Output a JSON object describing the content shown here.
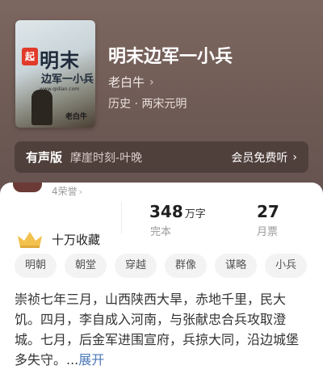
{
  "cover": {
    "badge": "起",
    "title": "明末",
    "subtitle": "边军一小兵",
    "url": "www.qidian.com",
    "author": "老白牛"
  },
  "book": {
    "title": "明末边军一小兵",
    "author": "老白牛",
    "genre": "历史 · 两宋元明"
  },
  "audio": {
    "label": "有声版",
    "narrator": "摩崖时刻-叶晚",
    "vip": "会员免费听"
  },
  "honor": {
    "label": "4荣誉"
  },
  "collection": {
    "label": "十万收藏"
  },
  "stats": {
    "words_num": "348",
    "words_unit": "万字",
    "words_label": "完本",
    "tickets_num": "27",
    "tickets_label": "月票"
  },
  "tags": [
    "明朝",
    "朝堂",
    "穿越",
    "群像",
    "谋略",
    "小兵"
  ],
  "intro": {
    "text": "崇祯七年三月，山西陕西大旱，赤地千里，民大饥。四月，李自成入河南，与张献忠合兵攻取澄城。七月，后金军进围宣府，兵掠大同，沿边城堡多失守。...",
    "more": "展开"
  },
  "colors": {
    "hero_bg": "#6f5b55",
    "link": "#4a78b8",
    "badge": "#e23a2a",
    "crown": "#f2c14e"
  }
}
